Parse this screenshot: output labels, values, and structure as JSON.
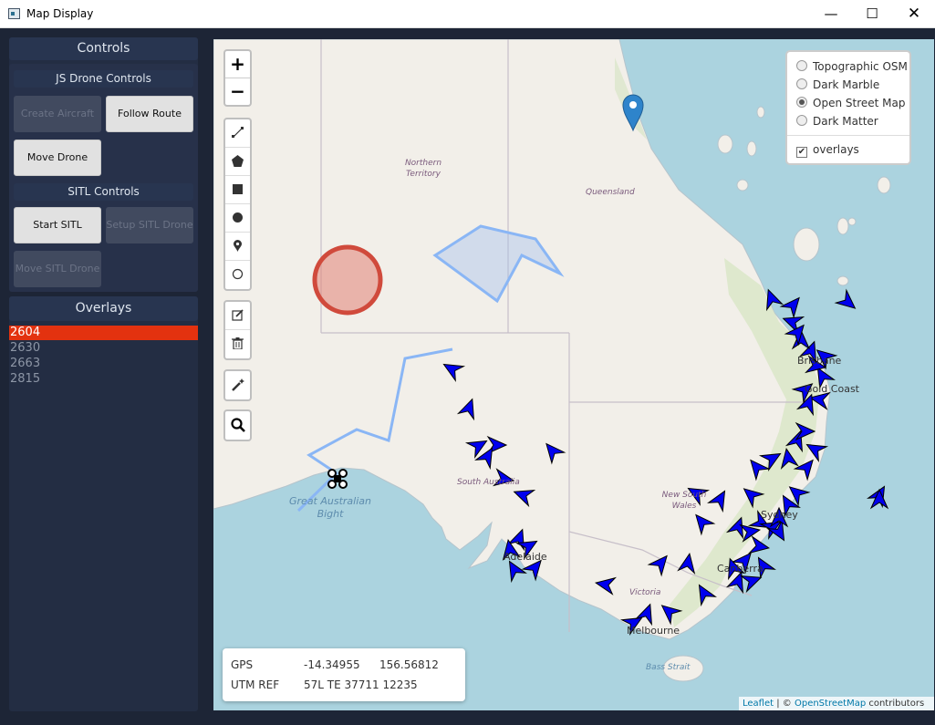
{
  "window": {
    "title": "Map Display",
    "minimize": "—",
    "maximize": "☐",
    "close": "✕"
  },
  "controls": {
    "header": "Controls",
    "js_section": "JS Drone Controls",
    "create_aircraft": "Create Aircraft",
    "follow_route": "Follow Route",
    "move_drone": "Move Drone",
    "sitl_section": "SITL Controls",
    "start_sitl": "Start SITL",
    "setup_sitl_drone": "Setup SITL Drone",
    "move_sitl_drone": "Move SITL Drone"
  },
  "overlays": {
    "header": "Overlays",
    "items": [
      "2604",
      "2630",
      "2663",
      "2815"
    ],
    "selected_index": 0
  },
  "map": {
    "zoom_in": "+",
    "zoom_out": "−",
    "draw_tools": [
      "polyline-icon",
      "polygon-icon",
      "rectangle-icon",
      "circle-icon",
      "marker-icon",
      "circle-marker-icon"
    ],
    "edit_tools": [
      "edit-icon",
      "delete-icon"
    ],
    "labels": {
      "northern_territory_1": "Northern",
      "northern_territory_2": "Territory",
      "queensland": "Queensland",
      "south_australia": "South Australia",
      "nsw_1": "New South",
      "nsw_2": "Wales",
      "victoria": "Victoria",
      "bight_1": "Great Australian",
      "bight_2": "Bight",
      "bass_strait": "Bass Strait",
      "gold_coast": "Gold Coast",
      "sydney": "Sydney",
      "canberra": "Canberra",
      "melbourne": "Melbourne",
      "adelaide": "Adelaide",
      "brisbane": "Brisbane"
    },
    "layers": {
      "options": [
        "Topographic OSM",
        "Dark Marble",
        "Open Street Map",
        "Dark Matter"
      ],
      "selected_index": 2,
      "overlays_label": "overlays",
      "overlays_checked": true
    },
    "gps": {
      "gps_label": "GPS",
      "lat": "-14.34955",
      "lon": "156.56812",
      "utm_label": "UTM REF",
      "utm_value": "57L TE 37711 12235"
    },
    "attribution": {
      "leaflet": "Leaflet",
      "separator": " | © ",
      "osm": "OpenStreetMap",
      "suffix": " contributors"
    },
    "colors": {
      "water": "#abd3df",
      "land": "#f2efe9",
      "drone_arrow": "#0000ee",
      "route": "#8ab6f5",
      "circle": "#d04a3c",
      "selected_overlay": "#e3320f"
    }
  }
}
